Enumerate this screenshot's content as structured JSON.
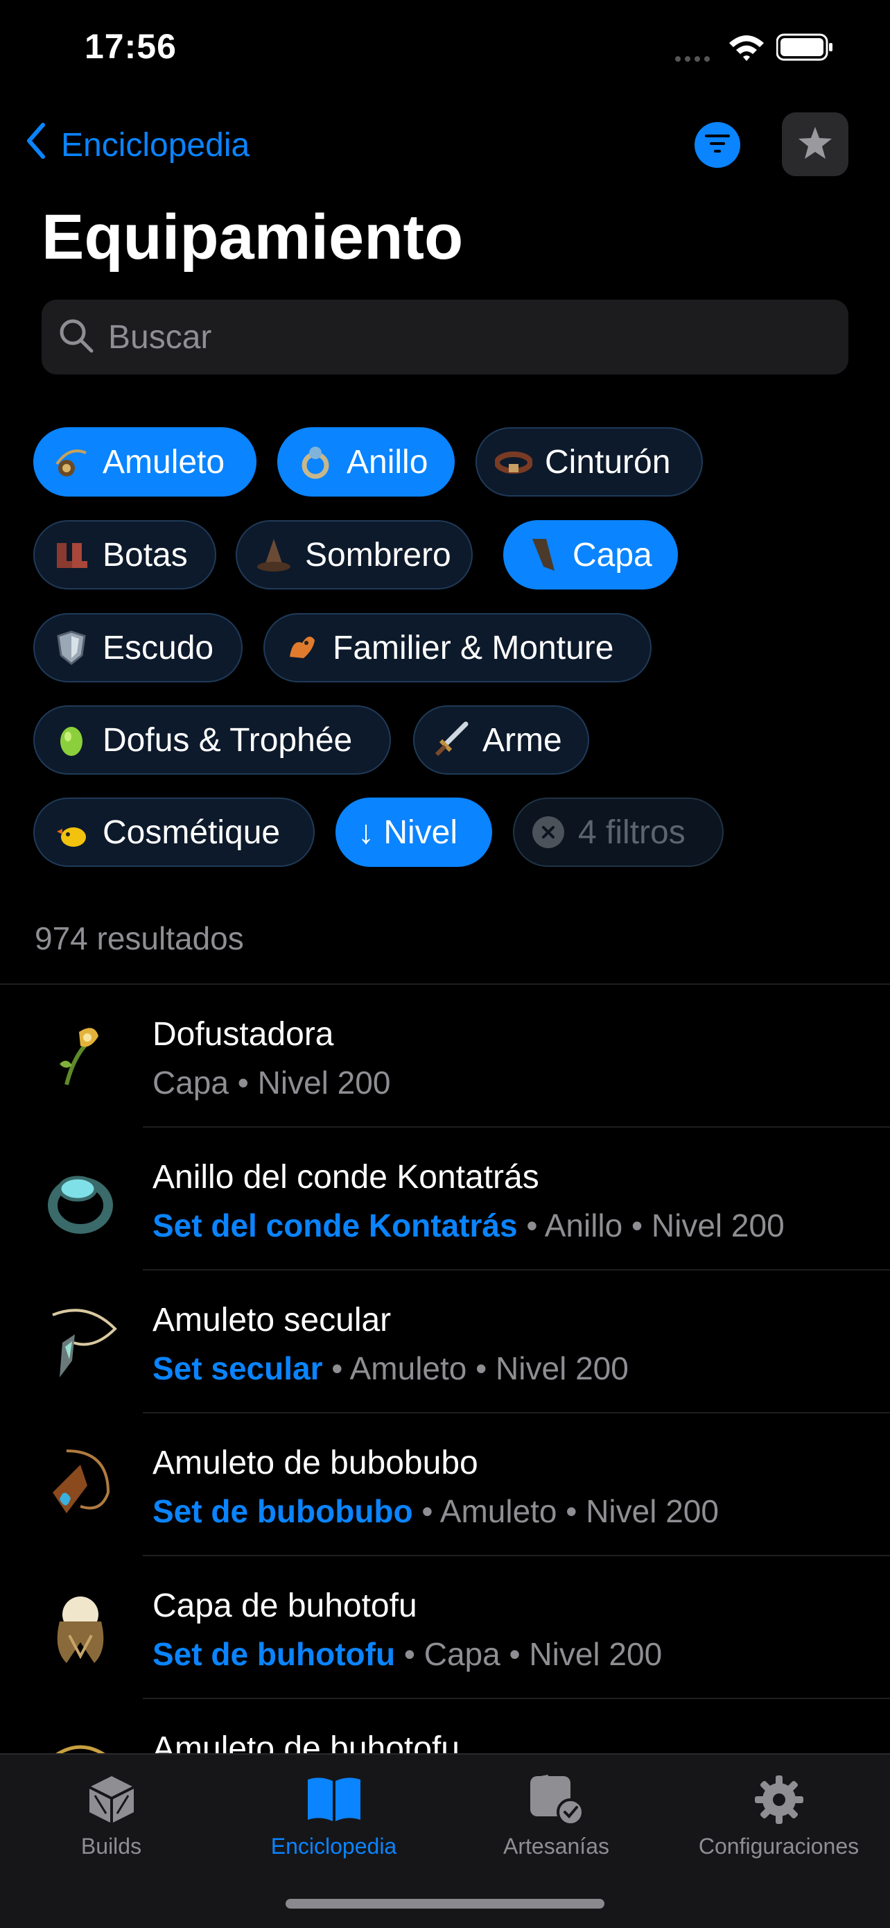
{
  "status": {
    "time": "17:56"
  },
  "nav": {
    "back_label": "Enciclopedia"
  },
  "page": {
    "title": "Equipamiento"
  },
  "search": {
    "placeholder": "Buscar"
  },
  "chips": [
    {
      "label": "Amuleto",
      "selected": true,
      "icon": "amulet-icon"
    },
    {
      "label": "Anillo",
      "selected": true,
      "icon": "ring-icon"
    },
    {
      "label": "Cinturón",
      "selected": false,
      "icon": "belt-icon"
    },
    {
      "label": "Botas",
      "selected": false,
      "icon": "boots-icon"
    },
    {
      "label": "Sombrero",
      "selected": false,
      "icon": "hat-icon"
    },
    {
      "label": "Capa",
      "selected": true,
      "icon": "cape-icon"
    },
    {
      "label": "Escudo",
      "selected": false,
      "icon": "shield-icon"
    },
    {
      "label": "Familier & Monture",
      "selected": false,
      "icon": "pet-icon"
    },
    {
      "label": "Dofus & Trophée",
      "selected": false,
      "icon": "dofus-egg-icon"
    },
    {
      "label": "Arme",
      "selected": false,
      "icon": "sword-icon"
    },
    {
      "label": "Cosmétique",
      "selected": false,
      "icon": "cosmetic-icon"
    },
    {
      "label": "↓ Nivel",
      "selected": true,
      "icon": ""
    },
    {
      "label": "4 filtros",
      "selected": false,
      "icon": "clear-icon"
    }
  ],
  "results": {
    "count_label": "974 resultados",
    "items": [
      {
        "name": "Dofustadora",
        "set": "",
        "type": "Capa",
        "level": "Nivel 200"
      },
      {
        "name": "Anillo del conde Kontatrás",
        "set": "Set del conde Kontatrás",
        "type": "Anillo",
        "level": "Nivel 200"
      },
      {
        "name": "Amuleto secular",
        "set": "Set secular",
        "type": "Amuleto",
        "level": "Nivel 200"
      },
      {
        "name": "Amuleto de bubobubo",
        "set": "Set de bubobubo",
        "type": "Amuleto",
        "level": "Nivel 200"
      },
      {
        "name": "Capa de buhotofu",
        "set": "Set de buhotofu",
        "type": "Capa",
        "level": "Nivel 200"
      },
      {
        "name": "Amuleto de buhotofu",
        "set": "",
        "type": "",
        "level": ""
      }
    ],
    "separator": "•"
  },
  "tabs": [
    {
      "label": "Builds",
      "active": false,
      "icon": "cube-icon"
    },
    {
      "label": "Enciclopedia",
      "active": true,
      "icon": "book-icon"
    },
    {
      "label": "Artesanías",
      "active": false,
      "icon": "craft-check-icon"
    },
    {
      "label": "Configuraciones",
      "active": false,
      "icon": "gear-icon"
    }
  ],
  "colors": {
    "accent": "#0a84ff",
    "background": "#000000",
    "chip_bg": "#0d1a2b",
    "secondary_text": "#8e8e93"
  }
}
